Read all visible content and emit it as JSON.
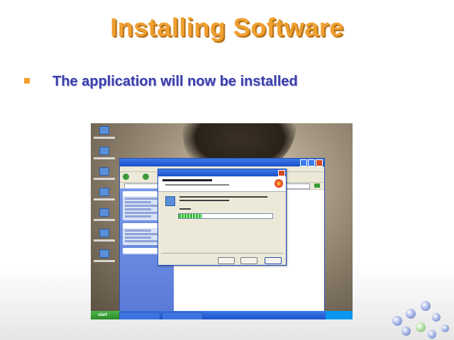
{
  "slide": {
    "title": "Installing Software",
    "bullet": "The application will now be installed"
  },
  "screenshot": {
    "taskbar": {
      "start_label": "start"
    },
    "installer": {
      "progress_fraction": 0.25
    }
  },
  "colors": {
    "title": "#f0a030",
    "bullet_text": "#3b3fa8",
    "bullet_mark": "#f0a030"
  }
}
